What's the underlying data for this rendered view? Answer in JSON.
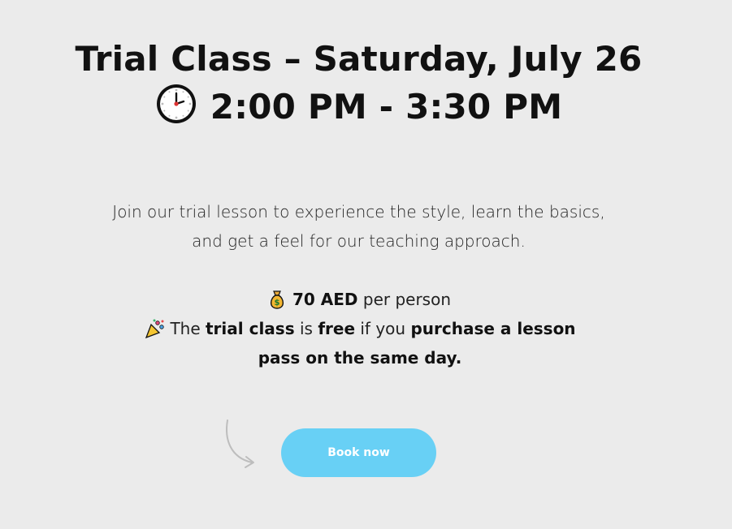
{
  "heading": {
    "line1": "Trial Class – Saturday, July 26",
    "time": "2:00 PM - 3:30 PM",
    "time_icon": "clock-icon"
  },
  "description": {
    "line1": "Join our trial lesson to experience the style, learn the basics,",
    "line2": "and get a feel for our teaching approach."
  },
  "price": {
    "icon": "money-bag-icon",
    "amount": "70 AED",
    "suffix": "per person"
  },
  "promo": {
    "icon": "party-popper-icon",
    "text_1": "The",
    "bold_1": "trial class",
    "text_2": "is",
    "bold_2": "free",
    "text_3": "if you",
    "bold_3": "purchase a lesson pass on the same day."
  },
  "cta": {
    "label": "Book now",
    "color": "#68d0f5"
  },
  "colors": {
    "background": "#ebebeb",
    "text": "#111111"
  }
}
